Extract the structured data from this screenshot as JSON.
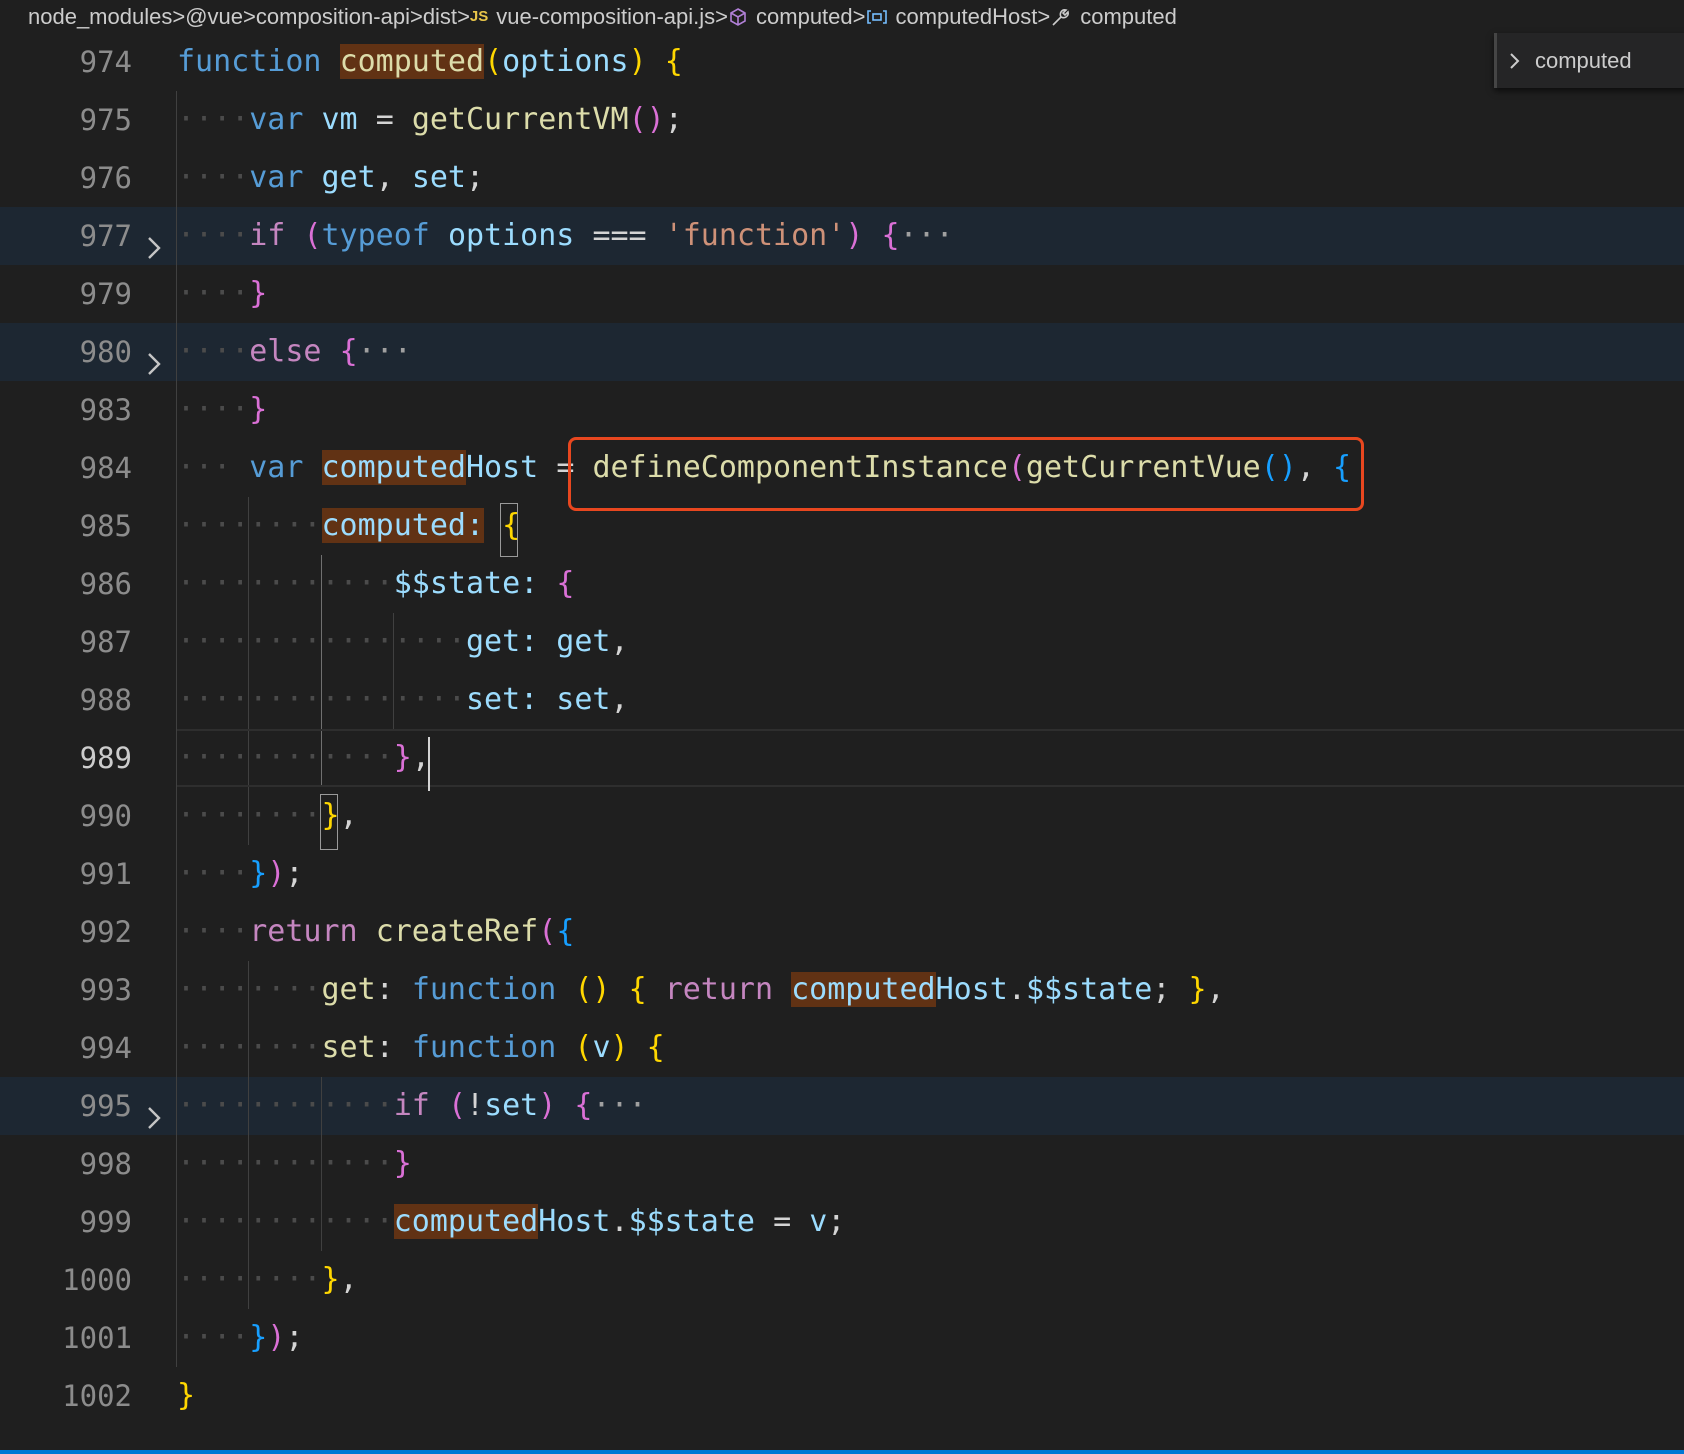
{
  "breadcrumb": {
    "items": [
      {
        "label": "node_modules",
        "icon": ""
      },
      {
        "label": "@vue",
        "icon": ""
      },
      {
        "label": "composition-api",
        "icon": ""
      },
      {
        "label": "dist",
        "icon": ""
      },
      {
        "label": "vue-composition-api.js",
        "icon": "js-file-icon",
        "icon_text": "JS"
      },
      {
        "label": "computed",
        "icon": "cube-icon"
      },
      {
        "label": "computedHost",
        "icon": "variable-icon"
      },
      {
        "label": "computed",
        "icon": "wrench-icon"
      }
    ],
    "separator": ">"
  },
  "sticky_scroll": {
    "label": "computed"
  },
  "colors": {
    "background": "#1f1f1f",
    "folded_line": "#1d2732",
    "highlight": "#613214",
    "callout_border": "#e8471f",
    "status_bar": "#0078d4"
  },
  "editor": {
    "lines": [
      {
        "num": "974"
      },
      {
        "num": "975"
      },
      {
        "num": "976"
      },
      {
        "num": "977",
        "folded": true
      },
      {
        "num": "979"
      },
      {
        "num": "980",
        "folded": true
      },
      {
        "num": "983"
      },
      {
        "num": "984"
      },
      {
        "num": "985"
      },
      {
        "num": "986"
      },
      {
        "num": "987"
      },
      {
        "num": "988"
      },
      {
        "num": "989",
        "current": true
      },
      {
        "num": "990"
      },
      {
        "num": "991"
      },
      {
        "num": "992"
      },
      {
        "num": "993"
      },
      {
        "num": "994"
      },
      {
        "num": "995",
        "folded": true
      },
      {
        "num": "998"
      },
      {
        "num": "999"
      },
      {
        "num": "1000"
      },
      {
        "num": "1001"
      },
      {
        "num": "1002"
      }
    ],
    "tokens": {
      "kw_function": "function",
      "kw_var": "var",
      "kw_if": "if",
      "kw_typeof": "typeof",
      "kw_else": "else",
      "kw_return": "return",
      "fn_computed": "computed",
      "param_options": "options",
      "id_vm": "vm",
      "fn_getCurrentVM": "getCurrentVM",
      "id_get": "get",
      "id_set": "set",
      "op_strict_eq": "===",
      "str_function": "'function'",
      "ellipsis": "···",
      "id_computedHost": "computedHost",
      "fn_defineComponentInstance": "defineComponentInstance",
      "fn_getCurrentVue": "getCurrentVue",
      "key_computed": "computed",
      "key_state": "$$state",
      "key_get": "get",
      "key_set": "set",
      "fn_createRef": "createRef",
      "param_v": "v",
      "prop_state": "$$state",
      "hl_computed": "computed",
      "host_suffix": "Host"
    }
  }
}
